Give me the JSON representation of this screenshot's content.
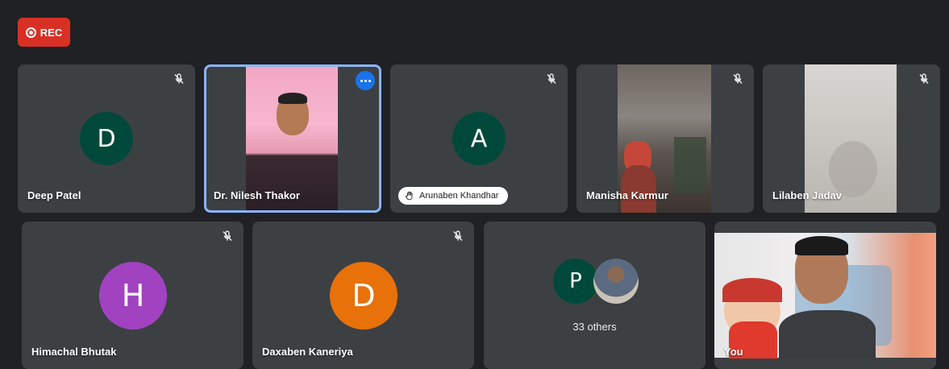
{
  "recording": {
    "label": "REC"
  },
  "participants": [
    {
      "name": "Deep Patel",
      "initial": "D",
      "avatar_color": "#00493a",
      "muted": true
    },
    {
      "name": "Dr. Nilesh Thakor",
      "video": true,
      "active_speaker": true
    },
    {
      "name": "Arunaben Khandhar",
      "initial": "A",
      "avatar_color": "#00493a",
      "muted": true,
      "hand_raised": true
    },
    {
      "name": "Manisha Karmur",
      "video": true,
      "muted": true
    },
    {
      "name": "Lilaben Jadav",
      "video": true,
      "muted": true
    },
    {
      "name": "Himachal Bhutak",
      "initial": "H",
      "avatar_color": "#a142c0",
      "muted": true
    },
    {
      "name": "Daxaben Kaneriya",
      "initial": "D",
      "avatar_color": "#e8710a",
      "muted": true
    }
  ],
  "others": {
    "label": "33 others",
    "initial": "P",
    "avatar_color": "#00493a"
  },
  "self": {
    "name": "You"
  },
  "colors": {
    "background": "#202124",
    "tile": "#3c4043",
    "accent": "#8ab4f8",
    "rec": "#d93025"
  }
}
